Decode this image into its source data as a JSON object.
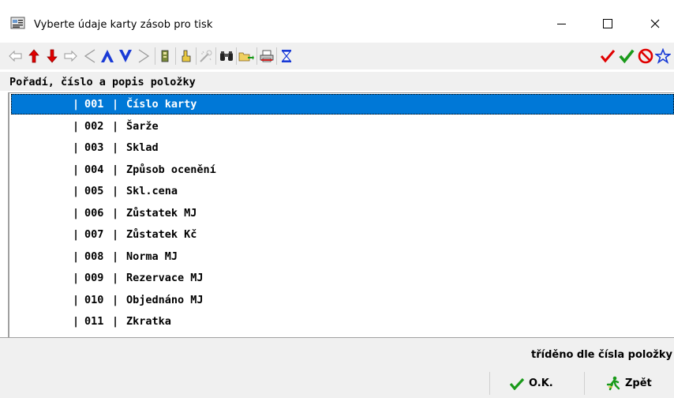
{
  "window": {
    "title": "Vyberte údaje karty zásob pro tisk",
    "controls": {
      "minimize": "—",
      "maximize": "☐",
      "close": "✕"
    }
  },
  "toolbar": {
    "icons": [
      "first-arrow-icon",
      "move-up-icon",
      "move-down-icon",
      "last-arrow-icon",
      "prev-page-icon",
      "blue-up-icon",
      "blue-down-icon",
      "next-page-icon",
      "hand-icon",
      "pointer-icon",
      "wizard-icon",
      "binoculars-icon",
      "folder-arrow-icon",
      "printer-icon",
      "hourglass-icon"
    ],
    "right_icons": [
      "check-red-icon",
      "check-green-icon",
      "cancel-icon",
      "star-icon"
    ]
  },
  "list": {
    "header": "Pořadí, číslo a popis položky",
    "items": [
      {
        "num": "001",
        "label": "Číslo karty",
        "selected": true
      },
      {
        "num": "002",
        "label": "Šarže"
      },
      {
        "num": "003",
        "label": "Sklad"
      },
      {
        "num": "004",
        "label": "Způsob ocenění"
      },
      {
        "num": "005",
        "label": "Skl.cena"
      },
      {
        "num": "006",
        "label": "Zůstatek MJ"
      },
      {
        "num": "007",
        "label": "Zůstatek Kč"
      },
      {
        "num": "008",
        "label": "Norma MJ"
      },
      {
        "num": "009",
        "label": "Rezervace MJ"
      },
      {
        "num": "010",
        "label": "Objednáno MJ"
      },
      {
        "num": "011",
        "label": "Zkratka"
      }
    ]
  },
  "status": {
    "text": "tříděno dle čísla položky"
  },
  "buttons": {
    "ok": "O.K.",
    "back": "Zpět"
  },
  "colors": {
    "selection": "#0078d7",
    "accent_red": "#e00000",
    "accent_green": "#1a9a1a",
    "accent_blue": "#1a3bd6"
  }
}
